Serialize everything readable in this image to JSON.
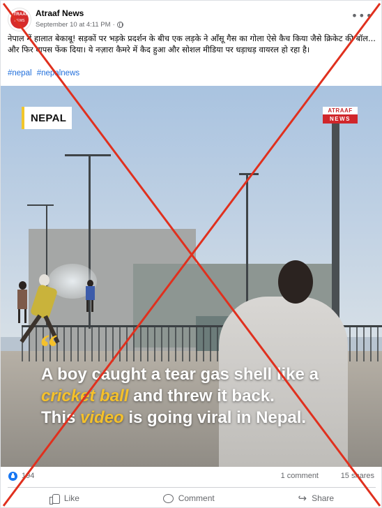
{
  "post": {
    "page_name": "Atraaf News",
    "avatar_text_top": "ATRAAF",
    "avatar_text_bottom": "NEWS",
    "timestamp": "September 10 at 4:11 PM",
    "separator": "·",
    "caption": "नेपाल में हालात बेकाबू! सड़कों पर भड़के प्रदर्शन के बीच एक लड़के ने आँसू गैस का गोला ऐसे कैच किया जैसे क्रिकेट की बॉल... और फिर वापस फेंक दिया। ये नज़ारा कैमरे में कैद हुआ और सोशल मीडिया पर धड़ाधड़ वायरल हो रहा है।",
    "hashtags": [
      "#nepal",
      "#nepalnews"
    ]
  },
  "media": {
    "location_tag": "NEPAL",
    "logo_top": "ATRAAF",
    "logo_bottom": "NEWS",
    "quote_mark": "“",
    "overlay_lines": [
      {
        "parts": [
          {
            "t": "A boy caught a tear gas shell like a",
            "hl": false
          }
        ]
      },
      {
        "parts": [
          {
            "t": "cricket ball",
            "hl": true
          },
          {
            "t": " and threw it back.",
            "hl": false
          }
        ]
      },
      {
        "parts": [
          {
            "t": "This ",
            "hl": false
          },
          {
            "t": "video",
            "hl": true
          },
          {
            "t": " is going viral in Nepal.",
            "hl": false
          }
        ]
      }
    ]
  },
  "stats": {
    "reactions": "194",
    "comments": "1 comment",
    "shares": "15 shares"
  },
  "actions": {
    "like": "Like",
    "comment": "Comment",
    "share": "Share"
  },
  "colors": {
    "stamp_red": "#e0301e",
    "accent_yellow": "#f5c12b",
    "link_blue": "#216fdb",
    "like_blue": "#1877f2"
  },
  "icons": [
    "more-icon",
    "globe-icon",
    "like-reaction-icon",
    "thumb-icon",
    "comment-icon",
    "share-icon",
    "quote-icon"
  ]
}
